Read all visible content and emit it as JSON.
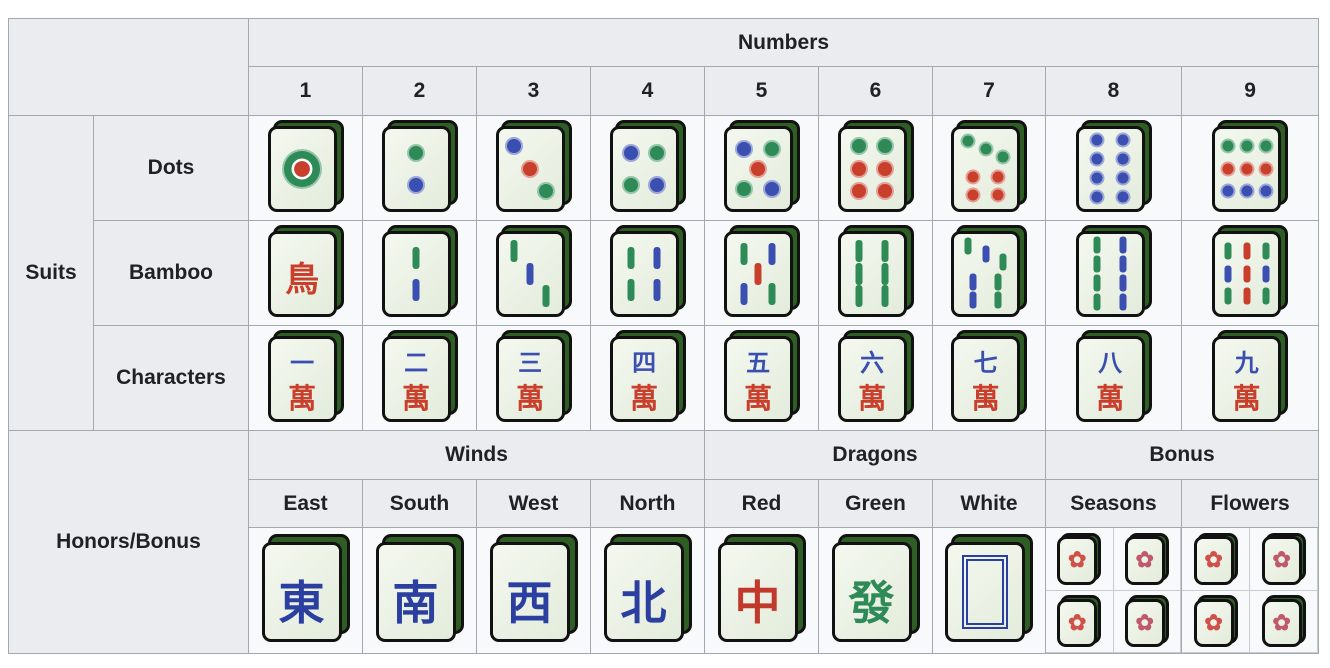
{
  "headers": {
    "numbers": "Numbers",
    "suits": "Suits",
    "honors_bonus": "Honors/Bonus",
    "winds": "Winds",
    "dragons": "Dragons",
    "bonus": "Bonus",
    "number_labels": [
      "1",
      "2",
      "3",
      "4",
      "5",
      "6",
      "7",
      "8",
      "9"
    ]
  },
  "suits": [
    {
      "label": "Dots",
      "kind": "dots"
    },
    {
      "label": "Bamboo",
      "kind": "bamboo"
    },
    {
      "label": "Characters",
      "kind": "characters"
    }
  ],
  "character_numerals": [
    "一",
    "二",
    "三",
    "四",
    "五",
    "六",
    "七",
    "八",
    "九"
  ],
  "character_suit_glyph": "萬",
  "bamboo_one_glyph": "鳥",
  "honors": [
    {
      "label": "East",
      "glyph": "東",
      "color": "#2a3fa0"
    },
    {
      "label": "South",
      "glyph": "南",
      "color": "#2a3fa0"
    },
    {
      "label": "West",
      "glyph": "西",
      "color": "#2a3fa0"
    },
    {
      "label": "North",
      "glyph": "北",
      "color": "#2a3fa0"
    },
    {
      "label": "Red",
      "glyph": "中",
      "color": "#c0392b"
    },
    {
      "label": "Green",
      "glyph": "發",
      "color": "#2e8b57"
    },
    {
      "label": "White",
      "glyph": "",
      "color": "#2a3fa0"
    }
  ],
  "bonus_groups": [
    {
      "label": "Seasons",
      "tiles": 4,
      "icon": "flower-icon"
    },
    {
      "label": "Flowers",
      "tiles": 4,
      "icon": "flower-icon"
    }
  ],
  "colors": {
    "blue": "#3a4fb0",
    "green": "#2e8b57",
    "red": "#c8402c",
    "tile_side": "#2f5e24"
  }
}
